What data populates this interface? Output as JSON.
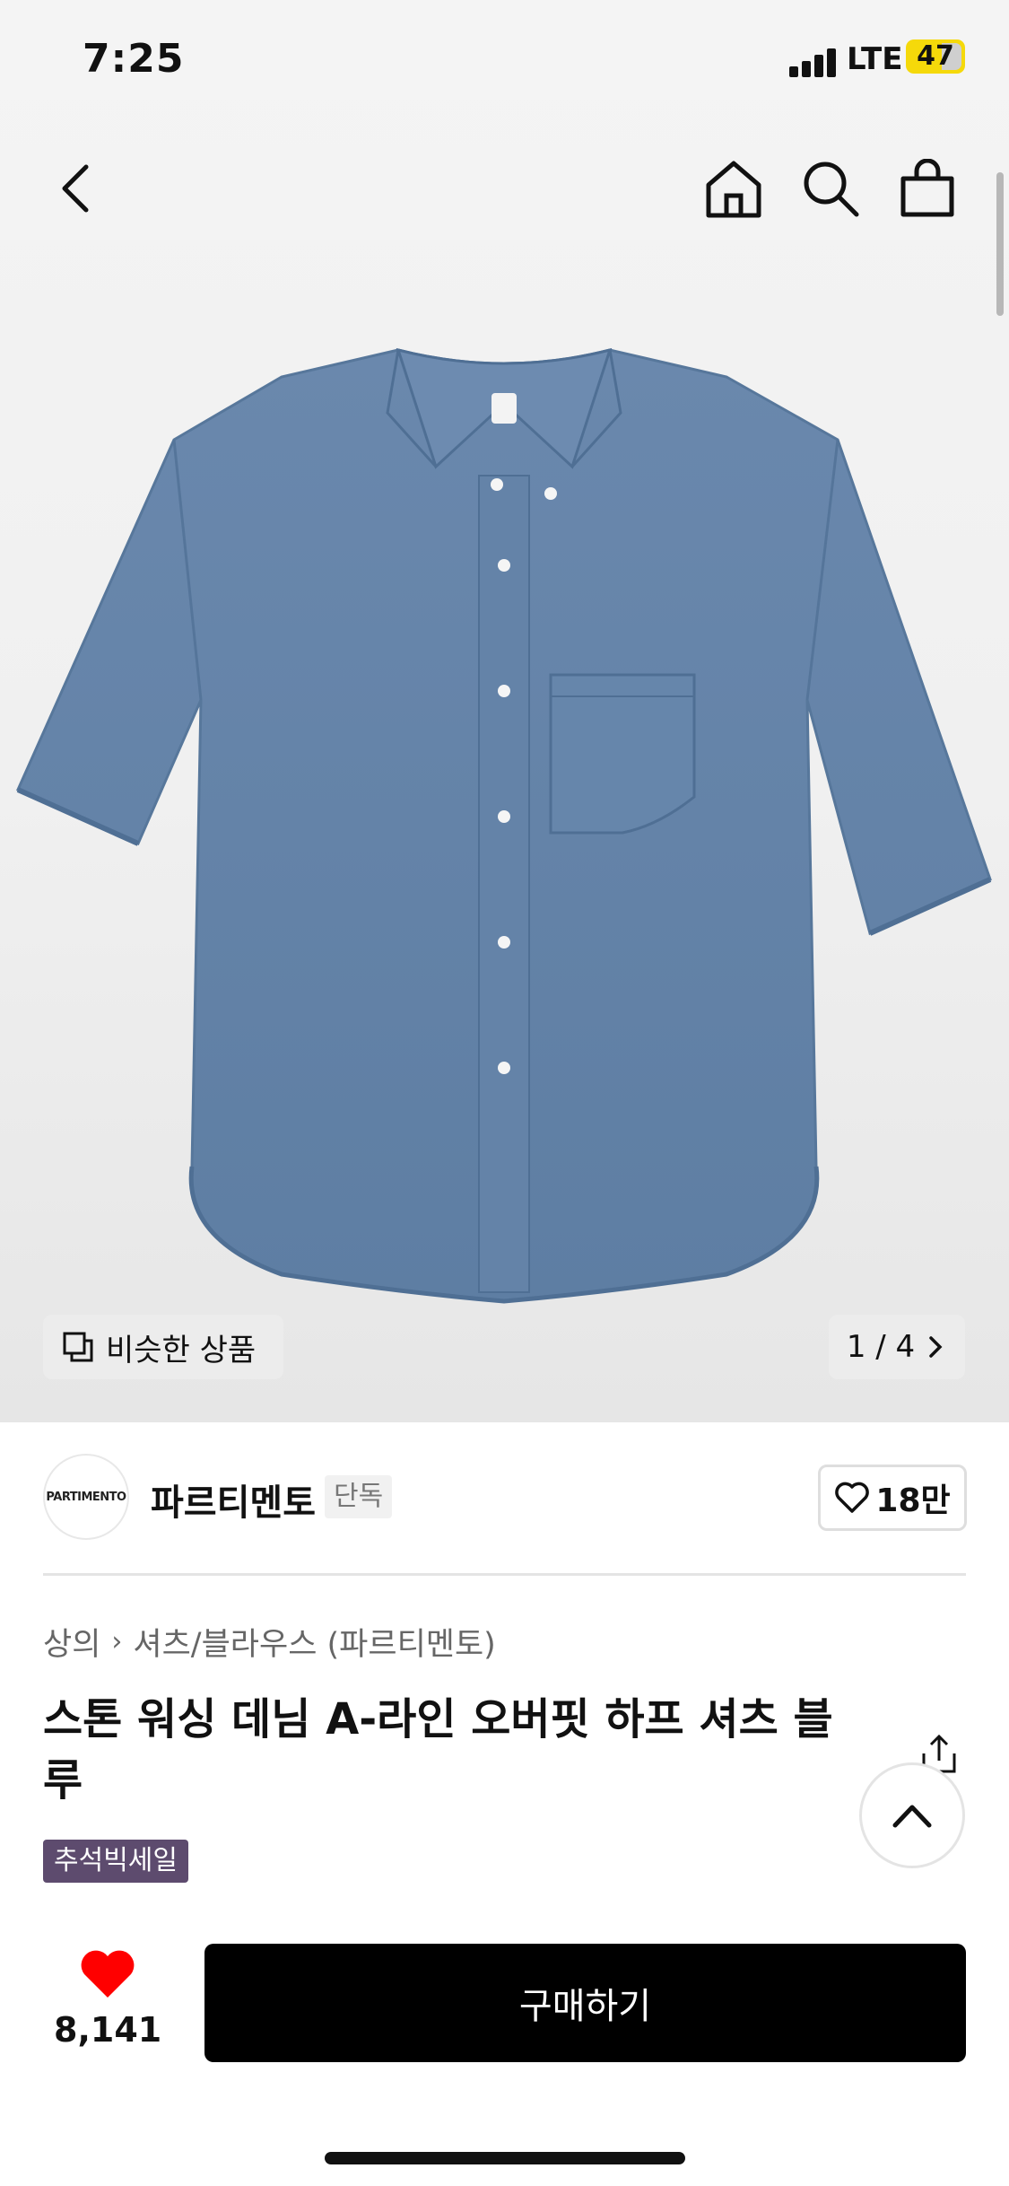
{
  "status_bar": {
    "time": "7:25",
    "network": "LTE",
    "battery": "47"
  },
  "nav": {
    "back_icon": "chevron-left-icon",
    "home_icon": "home-icon",
    "search_icon": "search-icon",
    "cart_icon": "shopping-bag-icon"
  },
  "gallery": {
    "similar_label": "비슷한 상품",
    "page_indicator": "1 / 4",
    "product_color": "#6584a8"
  },
  "brand": {
    "logo_text": "PARTIMENTO",
    "name": "파르티멘토",
    "badge": "단독",
    "likes": "18만"
  },
  "breadcrumb": {
    "category": "상의",
    "subcategory": "셔츠/블라우스 (파르티멘토)"
  },
  "product": {
    "title": "스톤 워싱 데님 A-라인 오버핏 하프 셔츠 블루",
    "sale_badge": "추석빅세일"
  },
  "bottom_bar": {
    "wish_count": "8,141",
    "buy_label": "구매하기"
  },
  "colors": {
    "sale_badge_bg": "#5d4b6e",
    "wish_heart": "#ff0000",
    "buy_button": "#000000"
  }
}
